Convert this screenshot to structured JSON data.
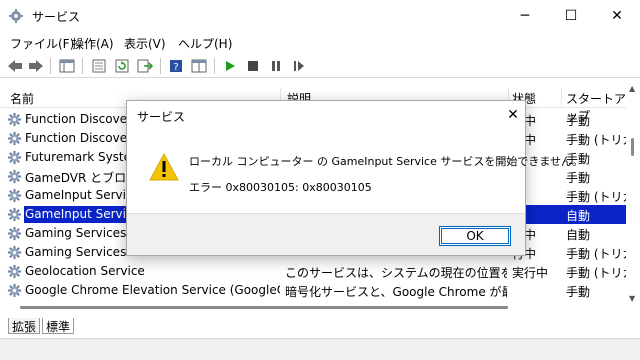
{
  "window": {
    "title": "サービス"
  },
  "menu": [
    "ファイル(F)",
    "操作(A)",
    "表示(V)",
    "ヘルプ(H)"
  ],
  "columns": {
    "name": "名前",
    "description": "説明",
    "status": "状態",
    "startup": "スタートアップ"
  },
  "rows": [
    {
      "name": "Function Discovery",
      "description": "",
      "status": "行中",
      "startup": "手動"
    },
    {
      "name": "Function Discovery",
      "description": "",
      "status": "行中",
      "startup": "手動 (トリガ"
    },
    {
      "name": "Futuremark System",
      "description": "",
      "status": "",
      "startup": "手動"
    },
    {
      "name": "GameDVR とブロードキ",
      "description": "",
      "status": "",
      "startup": "手動"
    },
    {
      "name": "GameInput Service",
      "description": "",
      "status": "",
      "startup": "手動 (トリガ"
    },
    {
      "name": "GameInput Service",
      "description": "",
      "status": "",
      "startup": "自動"
    },
    {
      "name": "Gaming Services",
      "description": "",
      "status": "行中",
      "startup": "自動"
    },
    {
      "name": "Gaming Services",
      "description": "",
      "status": "行中",
      "startup": "手動 (トリガ"
    },
    {
      "name": "Geolocation Service",
      "description": "このサービスは、システムの現在の位置を監...",
      "status": "実行中",
      "startup": "手動 (トリガ"
    },
    {
      "name": "Google Chrome Elevation Service (GoogleChro...",
      "description": "暗号化サービスと、Google Chrome が最...",
      "status": "",
      "startup": "手動"
    }
  ],
  "tabs": [
    "拡張",
    "標準"
  ],
  "dialog": {
    "title": "サービス",
    "message": "ローカル コンピューター の GameInput Service サービスを開始できません。",
    "error": "エラー 0x80030105: 0x80030105",
    "ok_label": "OK"
  },
  "colors": {
    "selection": "#0a24c8",
    "warning": "#f5c400",
    "accent": "#0067c0"
  },
  "icons": [
    "back-icon",
    "forward-icon",
    "console-tree-icon",
    "properties-icon",
    "refresh-icon",
    "export-icon",
    "help-icon",
    "view-icon",
    "play-icon",
    "stop-icon",
    "pause-icon",
    "resume-icon",
    "gear-icon",
    "warning-icon"
  ]
}
